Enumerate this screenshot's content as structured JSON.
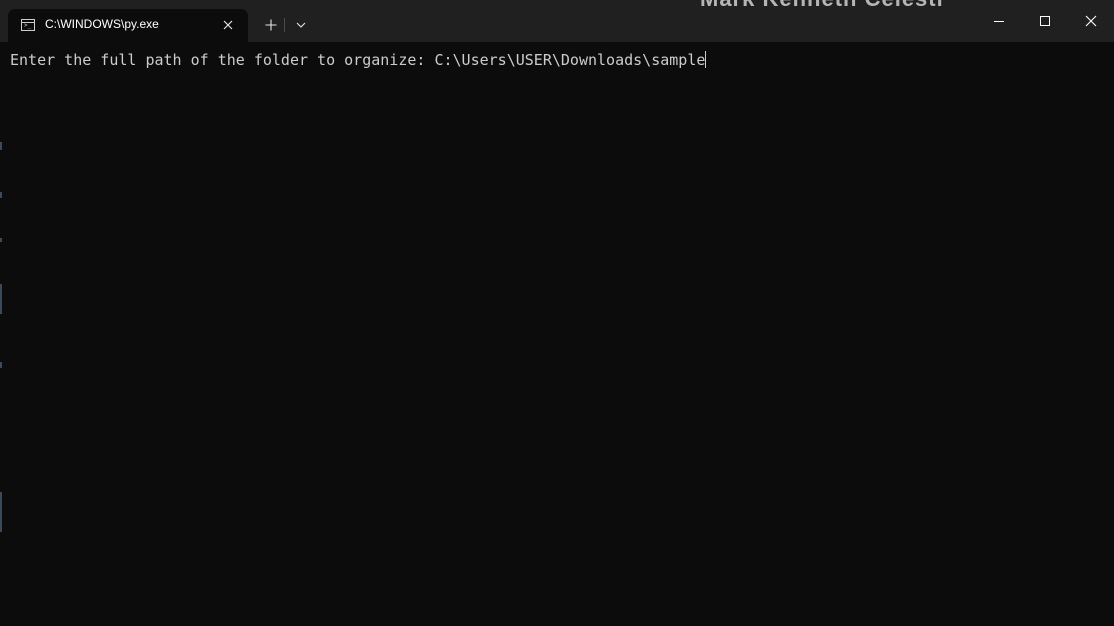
{
  "background_window": {
    "peek_text": "Mark Kenneth Celestr"
  },
  "tab": {
    "title": "C:\\WINDOWS\\py.exe",
    "icon": "terminal-icon"
  },
  "toolbar": {
    "new_tab_symbol": "+",
    "dropdown_icon": "chevron-down-icon"
  },
  "window_controls": {
    "minimize_icon": "minimize-icon",
    "maximize_icon": "maximize-icon",
    "close_icon": "close-icon"
  },
  "terminal": {
    "prompt": "Enter the full path of the folder to organize: ",
    "input": "C:\\Users\\USER\\Downloads\\sample"
  },
  "colors": {
    "terminal_bg": "#0c0c0c",
    "titlebar_bg": "#202020",
    "text": "#cccccc"
  }
}
